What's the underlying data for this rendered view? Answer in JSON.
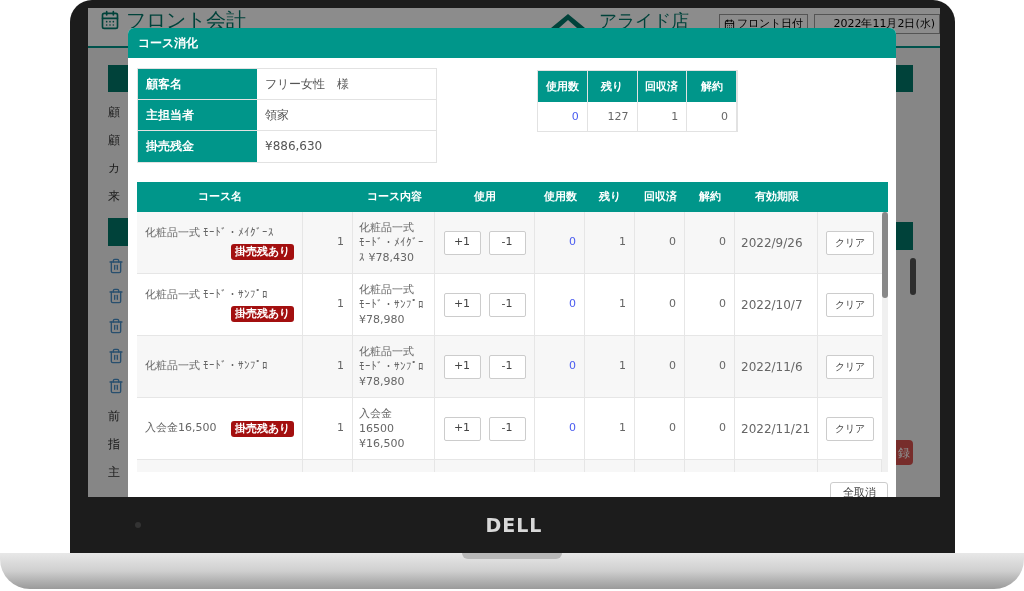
{
  "laptop": {
    "logo": "DELL"
  },
  "background_app": {
    "title": "フロント会計",
    "store": "アライド店",
    "date_label": "フロント日付",
    "date": "2022年11月2日(水)",
    "side_labels": [
      "顧",
      "顧",
      "カ",
      "来"
    ],
    "lower_labels": [
      "前",
      "指",
      "主"
    ],
    "register_button": "録"
  },
  "dialog": {
    "title": "コース消化",
    "customer": [
      {
        "label": "顧客名",
        "value": "フリー女性　様"
      },
      {
        "label": "主担当者",
        "value": "領家"
      },
      {
        "label": "掛売残金",
        "value": "¥886,630"
      }
    ],
    "summary": {
      "columns": [
        "使用数",
        "残り",
        "回収済",
        "解約"
      ],
      "values": [
        "0",
        "127",
        "1",
        "0"
      ]
    },
    "table": {
      "columns": [
        "コース名",
        "コース内容",
        "使用",
        "使用数",
        "残り",
        "回収済",
        "解約",
        "有効期限"
      ],
      "rows": [
        {
          "name": "化粧品一式 ﾓｰﾄﾞ・ﾒｲｸﾞｰｽ",
          "badge": "掛売残あり",
          "quantity": "1",
          "content": [
            "化粧品一式",
            "ﾓｰﾄﾞ・ﾒｲｸﾞｰｽ ¥78,430"
          ],
          "plus": "+1",
          "minus": "-1",
          "used": "0",
          "remaining": "1",
          "collected": "0",
          "cancelled": "0",
          "expiry": "2022/9/26",
          "clear": "クリア"
        },
        {
          "name": "化粧品一式 ﾓｰﾄﾞ・ｻﾝﾌﾟﾛ",
          "badge": "掛売残あり",
          "quantity": "1",
          "content": [
            "化粧品一式",
            "ﾓｰﾄﾞ・ｻﾝﾌﾟﾛ",
            "¥78,980"
          ],
          "plus": "+1",
          "minus": "-1",
          "used": "0",
          "remaining": "1",
          "collected": "0",
          "cancelled": "0",
          "expiry": "2022/10/7",
          "clear": "クリア"
        },
        {
          "name": "化粧品一式 ﾓｰﾄﾞ・ｻﾝﾌﾟﾛ",
          "quantity": "1",
          "content": [
            "化粧品一式",
            "ﾓｰﾄﾞ・ｻﾝﾌﾟﾛ",
            "¥78,980"
          ],
          "plus": "+1",
          "minus": "-1",
          "used": "0",
          "remaining": "1",
          "collected": "0",
          "cancelled": "0",
          "expiry": "2022/11/6",
          "clear": "クリア"
        },
        {
          "name": "入会金16,500",
          "badge": "掛売残あり",
          "quantity": "1",
          "content": [
            "入会金",
            "16500",
            "¥16,500"
          ],
          "plus": "+1",
          "minus": "-1",
          "used": "0",
          "remaining": "1",
          "collected": "0",
          "cancelled": "0",
          "expiry": "2022/11/21",
          "clear": "クリア"
        }
      ]
    },
    "cancel_all_button": "全取消"
  }
}
